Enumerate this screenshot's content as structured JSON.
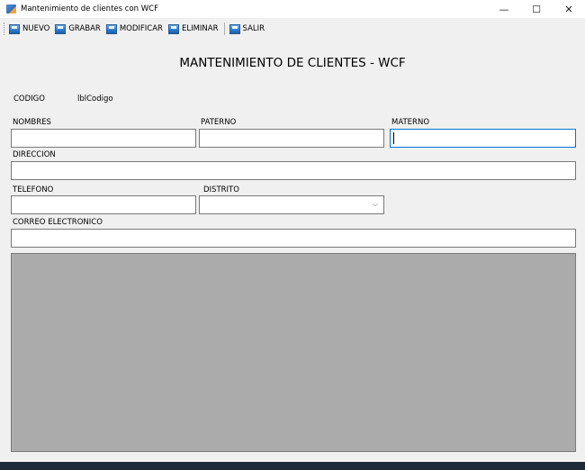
{
  "window": {
    "title": "Mantenimiento de clientes con WCF",
    "minimize_glyph": "—",
    "maximize_glyph": "☐",
    "close_glyph": "✕"
  },
  "toolbar": {
    "nuevo_label": "NUEVO",
    "grabar_label": "GRABAR",
    "modificar_label": "MODIFICAR",
    "eliminar_label": "ELIMINAR",
    "salir_label": "SALIR"
  },
  "form": {
    "heading": "MANTENIMIENTO DE CLIENTES - WCF",
    "codigo_label": "CODIGO",
    "codigo_value": "lblCodigo",
    "nombres_label": "NOMBRES",
    "paterno_label": "PATERNO",
    "materno_label": "MATERNO",
    "direccion_label": "DIRECCION",
    "telefono_label": "TELEFONO",
    "distrito_label": "DISTRITO",
    "correo_label": "CORREO ELECTRONICO",
    "nombres_value": "",
    "paterno_value": "",
    "materno_value": "",
    "direccion_value": "",
    "telefono_value": "",
    "distrito_value": "",
    "correo_value": ""
  },
  "colors": {
    "background": "#f0f0f0",
    "grid_background": "#ababab",
    "focus_border": "#0078d7"
  }
}
